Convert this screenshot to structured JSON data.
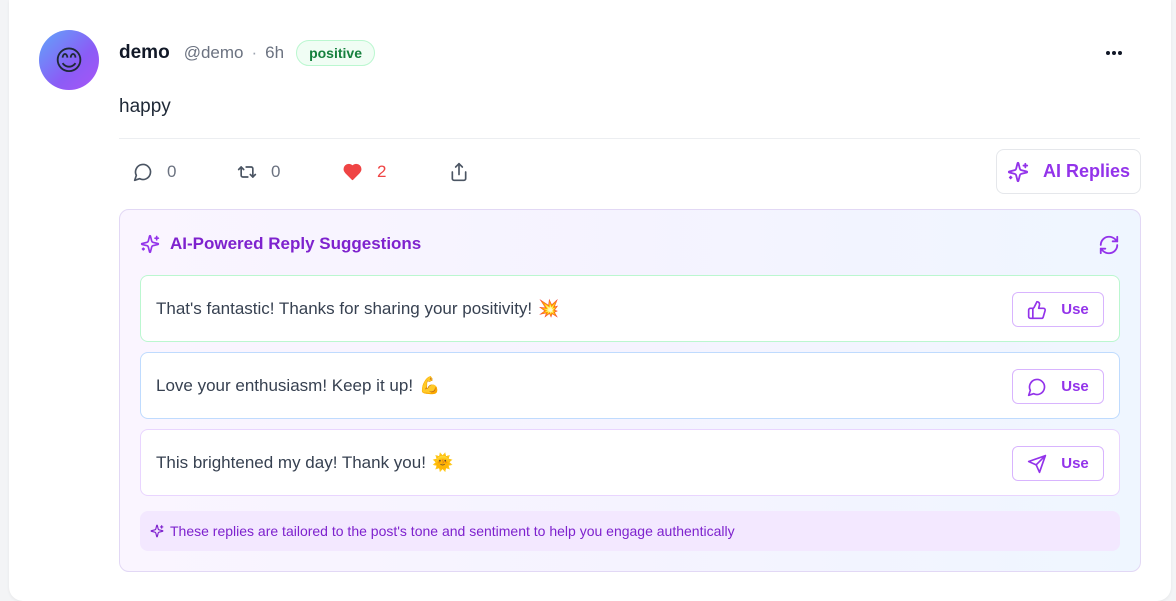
{
  "post": {
    "avatar_emoji": "😊",
    "author_name": "demo",
    "author_handle": "@demo",
    "separator": "·",
    "time": "6h",
    "sentiment_badge": "positive",
    "text": "happy",
    "more_icon": "ellipsis-icon"
  },
  "actions": {
    "reply_count": "0",
    "repost_count": "0",
    "like_count": "2",
    "ai_replies_label": "AI Replies"
  },
  "ai_panel": {
    "title": "AI-Powered Reply Suggestions",
    "suggestions": [
      {
        "text": "That's fantastic! Thanks for sharing your positivity!",
        "emoji": "💥",
        "use_label": "Use",
        "icon": "thumbs-up-icon"
      },
      {
        "text": "Love your enthusiasm! Keep it up!",
        "emoji": "💪",
        "use_label": "Use",
        "icon": "message-circle-icon"
      },
      {
        "text": "This brightened my day! Thank you!",
        "emoji": "🌞",
        "use_label": "Use",
        "icon": "send-icon"
      }
    ],
    "note": "These replies are tailored to the post's tone and sentiment to help you engage authentically"
  },
  "colors": {
    "accent": "#9333ea",
    "like": "#ef4444",
    "badge_text": "#15803d"
  }
}
